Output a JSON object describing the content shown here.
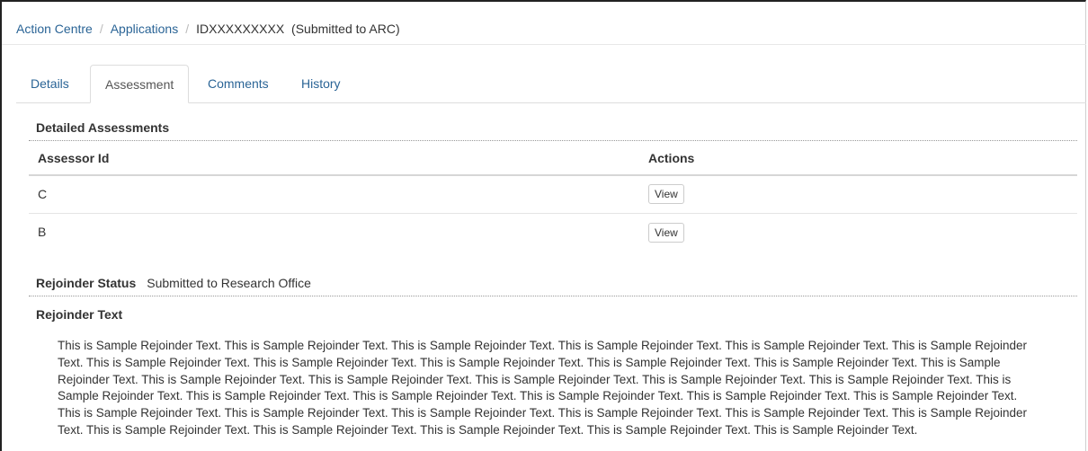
{
  "breadcrumb": {
    "items": [
      "Action Centre",
      "Applications"
    ],
    "current": "IDXXXXXXXXX",
    "current_status": "(Submitted to ARC)"
  },
  "tabs": [
    {
      "label": "Details",
      "active": false
    },
    {
      "label": "Assessment",
      "active": true
    },
    {
      "label": "Comments",
      "active": false
    },
    {
      "label": "History",
      "active": false
    }
  ],
  "detailed_assessments": {
    "heading": "Detailed Assessments",
    "columns": [
      "Assessor Id",
      "Actions"
    ],
    "rows": [
      {
        "assessor_id": "C",
        "action_label": "View"
      },
      {
        "assessor_id": "B",
        "action_label": "View"
      }
    ]
  },
  "rejoinder": {
    "status_label": "Rejoinder Status",
    "status_value": "Submitted to Research Office",
    "text_heading": "Rejoinder Text",
    "text": "This is Sample Rejoinder Text. This is Sample Rejoinder Text. This is Sample Rejoinder Text. This is Sample Rejoinder Text. This is Sample Rejoinder Text. This is Sample Rejoinder Text. This is Sample Rejoinder Text. This is Sample Rejoinder Text. This is Sample Rejoinder Text. This is Sample Rejoinder Text. This is Sample Rejoinder Text. This is Sample Rejoinder Text. This is Sample Rejoinder Text. This is Sample Rejoinder Text. This is Sample Rejoinder Text. This is Sample Rejoinder Text. This is Sample Rejoinder Text. This is Sample Rejoinder Text. This is Sample Rejoinder Text. This is Sample Rejoinder Text. This is Sample Rejoinder Text. This is Sample Rejoinder Text. This is Sample Rejoinder Text. This is Sample Rejoinder Text. This is Sample Rejoinder Text. This is Sample Rejoinder Text. This is Sample Rejoinder Text. This is Sample Rejoinder Text. This is Sample Rejoinder Text. This is Sample Rejoinder Text. This is Sample Rejoinder Text. This is Sample Rejoinder Text. This is Sample Rejoinder Text. This is Sample Rejoinder Text."
  }
}
